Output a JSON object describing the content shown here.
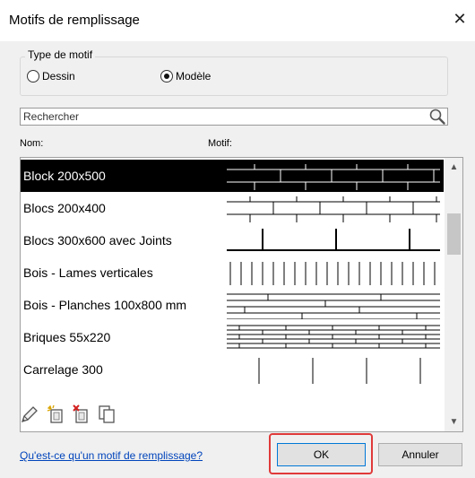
{
  "window": {
    "title": "Motifs de remplissage",
    "close_glyph": "✕"
  },
  "pattern_type": {
    "legend": "Type de motif",
    "options": [
      {
        "label": "Dessin",
        "checked": false
      },
      {
        "label": "Modèle",
        "checked": true
      }
    ]
  },
  "search": {
    "placeholder": "Rechercher",
    "value": ""
  },
  "columns": {
    "name": "Nom:",
    "pattern": "Motif:"
  },
  "list": {
    "selected_index": 0,
    "items": [
      {
        "name": "Block 200x500",
        "selected": true
      },
      {
        "name": "Blocs 200x400",
        "selected": false
      },
      {
        "name": "Blocs 300x600 avec Joints",
        "selected": false
      },
      {
        "name": "Bois - Lames verticales",
        "selected": false
      },
      {
        "name": "Bois - Planches 100x800 mm",
        "selected": false
      },
      {
        "name": "Briques 55x220",
        "selected": false
      },
      {
        "name": "Carrelage 300",
        "selected": false
      }
    ]
  },
  "toolbar": {
    "icons": [
      "pencil-edit-icon",
      "new-pattern-icon",
      "delete-pattern-icon",
      "duplicate-pattern-icon"
    ]
  },
  "help_link": "Qu'est-ce qu'un motif de remplissage?",
  "buttons": {
    "ok": "OK",
    "cancel": "Annuler"
  },
  "colors": {
    "highlight": "#e03a3a",
    "link": "#0044bb",
    "selection": "#000000"
  }
}
